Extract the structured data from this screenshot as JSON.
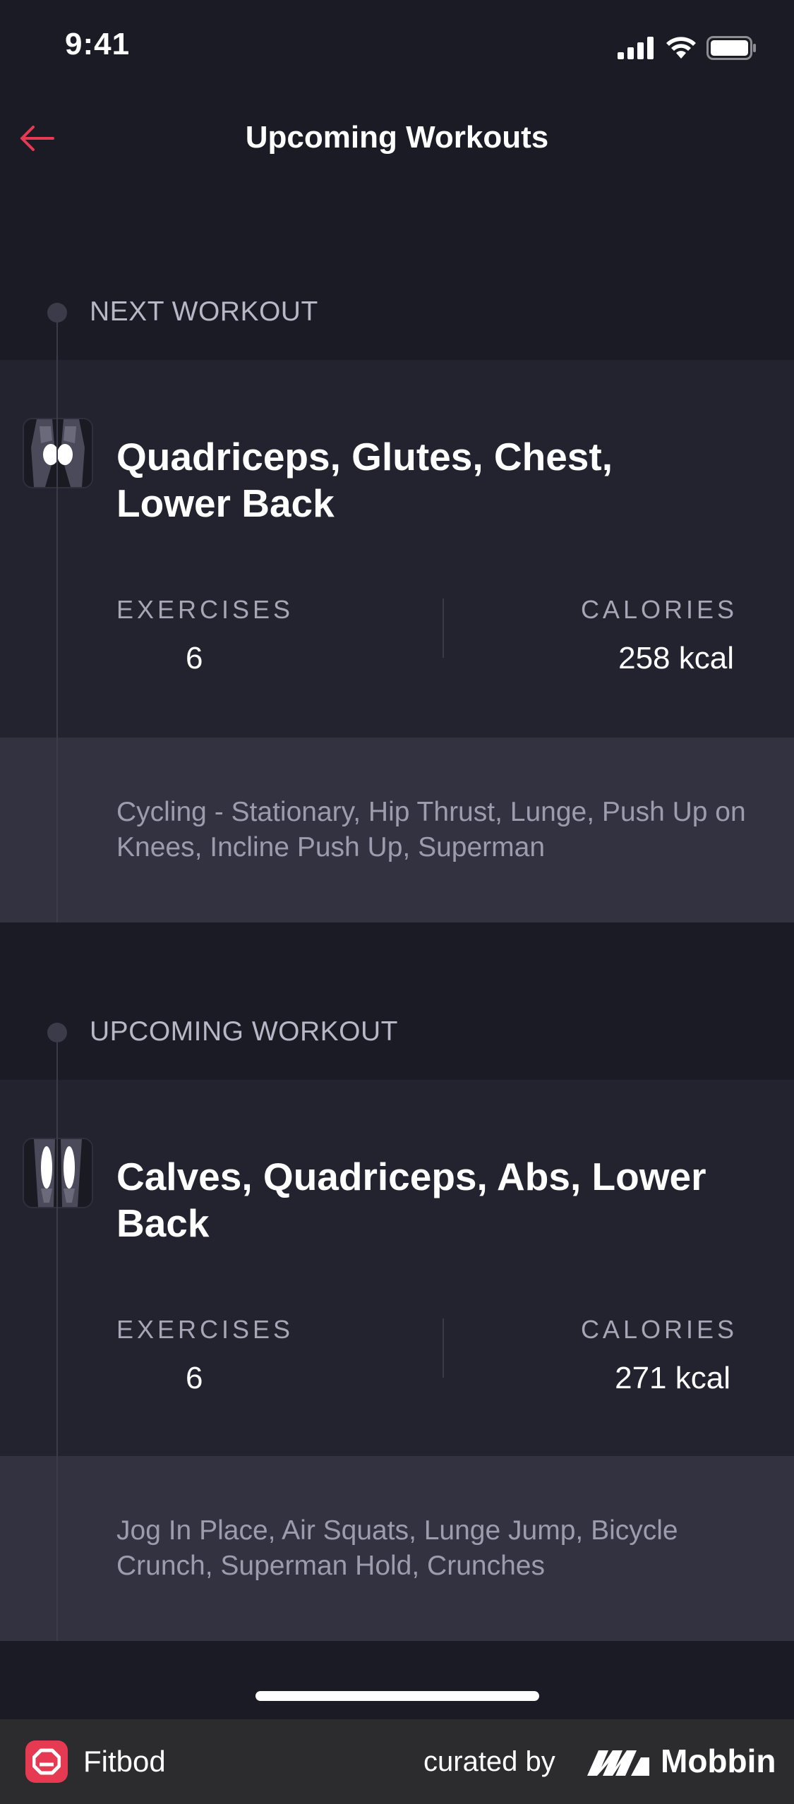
{
  "status_bar": {
    "time": "9:41"
  },
  "nav": {
    "title": "Upcoming Workouts"
  },
  "sections": [
    {
      "label": "NEXT WORKOUT",
      "title": "Quadriceps, Glutes, Chest, Lower Back",
      "exercises_label": "EXERCISES",
      "exercises_value": "6",
      "calories_label": "CALORIES",
      "calories_value": "258 kcal",
      "exercise_list": "Cycling - Stationary, Hip Thrust, Lunge, Push Up on Knees, Incline Push Up, Superman"
    },
    {
      "label": "UPCOMING WORKOUT",
      "title": "Calves, Quadriceps, Abs, Lower Back",
      "exercises_label": "EXERCISES",
      "exercises_value": "6",
      "calories_label": "CALORIES",
      "calories_value": "271 kcal",
      "exercise_list": "Jog In Place, Air Squats, Lunge Jump, Bicycle Crunch, Superman Hold, Crunches"
    }
  ],
  "footer": {
    "app_name": "Fitbod",
    "curated_by": "curated by",
    "brand": "Mobbin"
  },
  "colors": {
    "accent": "#e53a51",
    "background": "#1b1b25",
    "card": "#23232f",
    "exercise_panel": "#323241"
  }
}
